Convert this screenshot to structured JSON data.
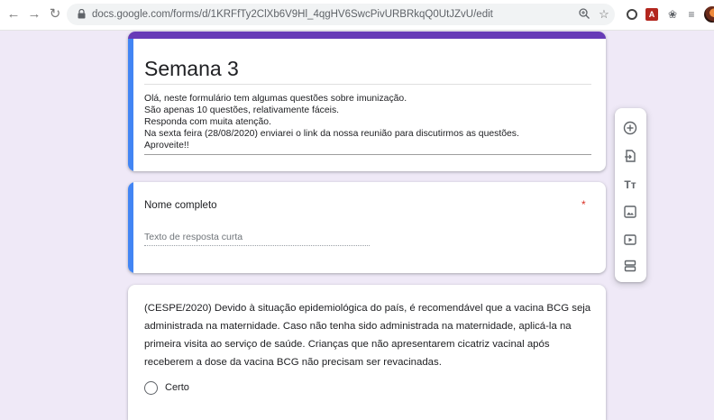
{
  "browser": {
    "url": "docs.google.com/forms/d/1KRFfTy2ClXb6V9Hl_4qgHV6SwcPivURBRkqQ0UtJZvU/edit",
    "nav": {
      "back_icon": "arrow-left-icon",
      "forward_icon": "arrow-right-icon",
      "reload_icon": "reload-icon"
    },
    "ext_pdf_label": "A"
  },
  "form": {
    "title": "Semana 3",
    "description": [
      "Olá, neste formulário tem algumas questões sobre imunização.",
      "São apenas 10 questões, relativamente fáceis.",
      "Responda com muita atenção.",
      "Na sexta feira (28/08/2020) enviarei o link da nossa reunião para discutirmos as questões.",
      "Aproveite!!"
    ],
    "accent_color": "#673ab7",
    "active_color": "#4285f4"
  },
  "question1": {
    "title": "Nome completo",
    "required_mark": "*",
    "placeholder": "Texto de resposta curta"
  },
  "question2": {
    "text": "(CESPE/2020) Devido à situação epidemiológica do país, é recomendável que a vacina BCG seja administrada na maternidade. Caso não tenha sido administrada na maternidade, aplicá-la na primeira visita ao serviço de saúde. Crianças que não apresentarem cicatriz vacinal após receberem a dose da vacina BCG não precisam ser revacinadas.",
    "options": [
      "Certo"
    ]
  },
  "side_toolbar": {
    "tools": [
      "add-question-icon",
      "import-questions-icon",
      "add-title-icon",
      "add-image-icon",
      "add-video-icon",
      "add-section-icon"
    ],
    "title_tool_label": "Tт"
  }
}
